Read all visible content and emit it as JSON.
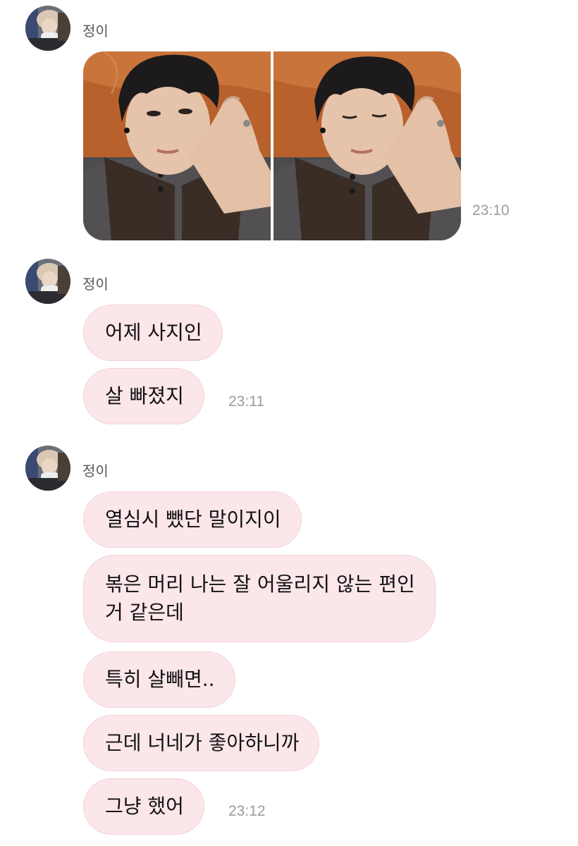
{
  "messages": [
    {
      "sender": "정이",
      "type": "photos",
      "time": "23:10"
    },
    {
      "sender": "정이",
      "type": "text",
      "lines": [
        "어제 사지인",
        "살 빠졌지"
      ],
      "time": "23:11"
    },
    {
      "sender": "정이",
      "type": "text",
      "lines": [
        "열심시 뺐단 말이지이",
        "볶은 머리 나는 잘 어울리지 않는 편인\n거 같은데",
        "특히 살빼면..",
        "근데 너네가 좋아하니까",
        "그냥 했어"
      ],
      "time": "23:12"
    }
  ],
  "colors": {
    "bubble_bg": "#fbe6ea",
    "bubble_border": "#f2d4da",
    "timestamp": "#9b9b9b",
    "photo_wall": "#b8612c"
  }
}
